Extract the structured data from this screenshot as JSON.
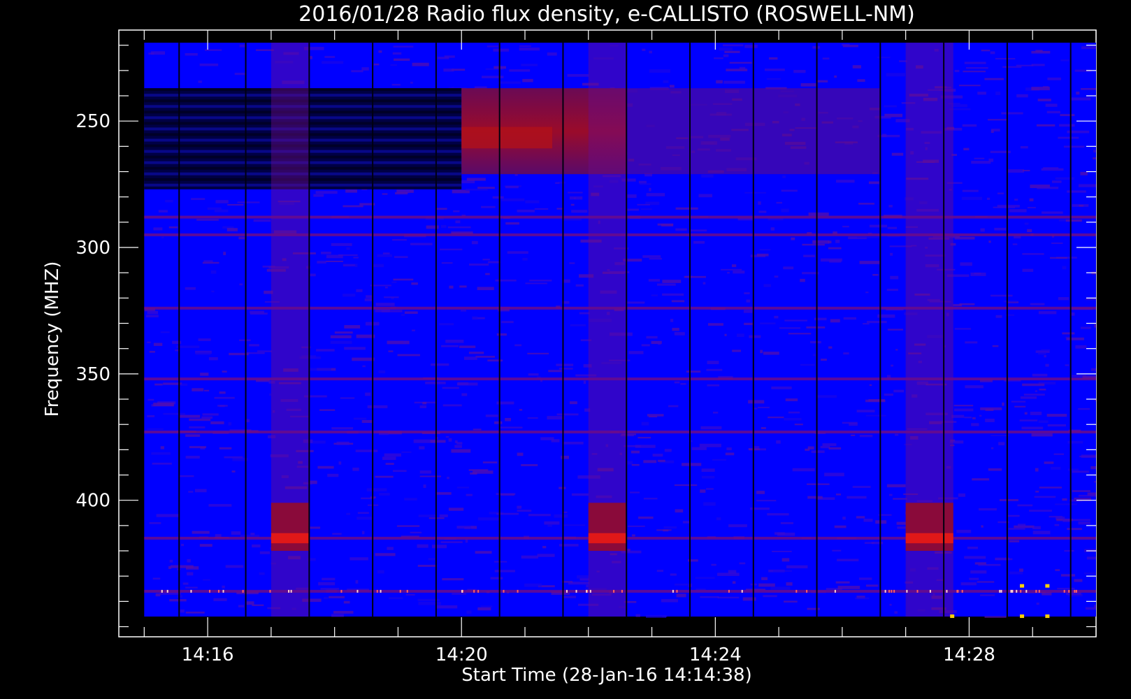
{
  "chart_data": {
    "type": "heatmap",
    "title": "2016/01/28  Radio flux density, e-CALLISTO (ROSWELL-NM)",
    "xlabel": "Start Time (28-Jan-16 14:14:38)",
    "ylabel": "Frequency (MHZ)",
    "x_start": "14:14:38",
    "x_range_minutes": [
      14.6,
      30.0
    ],
    "x_data_range_minutes": [
      15.0,
      30.0
    ],
    "xticks": [
      {
        "minute": 16,
        "label": "14:16"
      },
      {
        "minute": 20,
        "label": "14:20"
      },
      {
        "minute": 24,
        "label": "14:24"
      },
      {
        "minute": 28,
        "label": "14:28"
      }
    ],
    "ylim": [
      214,
      454
    ],
    "y_data_range": [
      219,
      446
    ],
    "y_inverted": true,
    "yticks": [
      250,
      300,
      350,
      400
    ],
    "colormap": {
      "low": "#000044",
      "mid": "#0000ff",
      "high": "#ff2020",
      "peak": "#ffd000"
    },
    "features": {
      "calibration_gaps_minutes": [
        15.55,
        16.6,
        17.6,
        18.6,
        19.6,
        20.6,
        21.6,
        22.6,
        23.6,
        24.6,
        25.6,
        26.6,
        27.6,
        28.6,
        29.6
      ],
      "dark_band_mhz": [
        237,
        277
      ],
      "dark_band_until_minute": 20.0,
      "enhanced_band_mhz": [
        237,
        271
      ],
      "enhanced_band_minutes": [
        20.0,
        22.6
      ],
      "interference_blocks": [
        {
          "minutes": [
            17.0,
            17.6
          ],
          "mhz": [
            401,
            420
          ]
        },
        {
          "minutes": [
            22.0,
            22.6
          ],
          "mhz": [
            401,
            420
          ]
        },
        {
          "minutes": [
            27.0,
            27.75
          ],
          "mhz": [
            401,
            420
          ]
        }
      ],
      "horizontal_lines_mhz": [
        288,
        295,
        324,
        352,
        373,
        415,
        436
      ]
    }
  }
}
